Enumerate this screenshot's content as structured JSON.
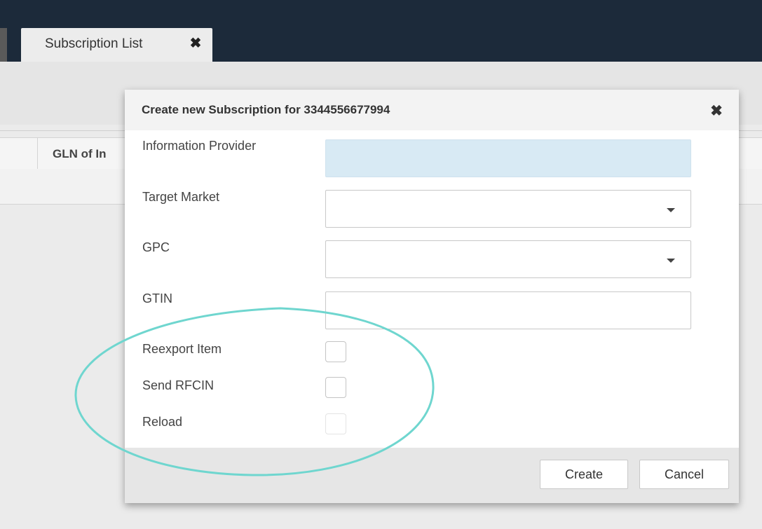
{
  "tabs": [
    {
      "label": "Subscription List",
      "close_icon": "close-icon"
    }
  ],
  "grid": {
    "columns": [
      "GLN of In"
    ]
  },
  "dialog": {
    "title": "Create new Subscription for 3344556677994",
    "close_icon": "close-icon",
    "fields": {
      "information_provider": {
        "label": "Information Provider",
        "value": ""
      },
      "target_market": {
        "label": "Target Market",
        "value": ""
      },
      "gpc": {
        "label": "GPC",
        "value": ""
      },
      "gtin": {
        "label": "GTIN",
        "value": ""
      },
      "reexport_item": {
        "label": "Reexport Item",
        "checked": false
      },
      "send_rfcin": {
        "label": "Send RFCIN",
        "checked": false
      },
      "reload": {
        "label": "Reload",
        "checked": false,
        "disabled": true
      }
    },
    "buttons": {
      "create": "Create",
      "cancel": "Cancel"
    }
  },
  "colors": {
    "topbar": "#1c2a3a",
    "readonly_input": "#d8eaf4",
    "annotation_ellipse": "#6fd6cf"
  }
}
